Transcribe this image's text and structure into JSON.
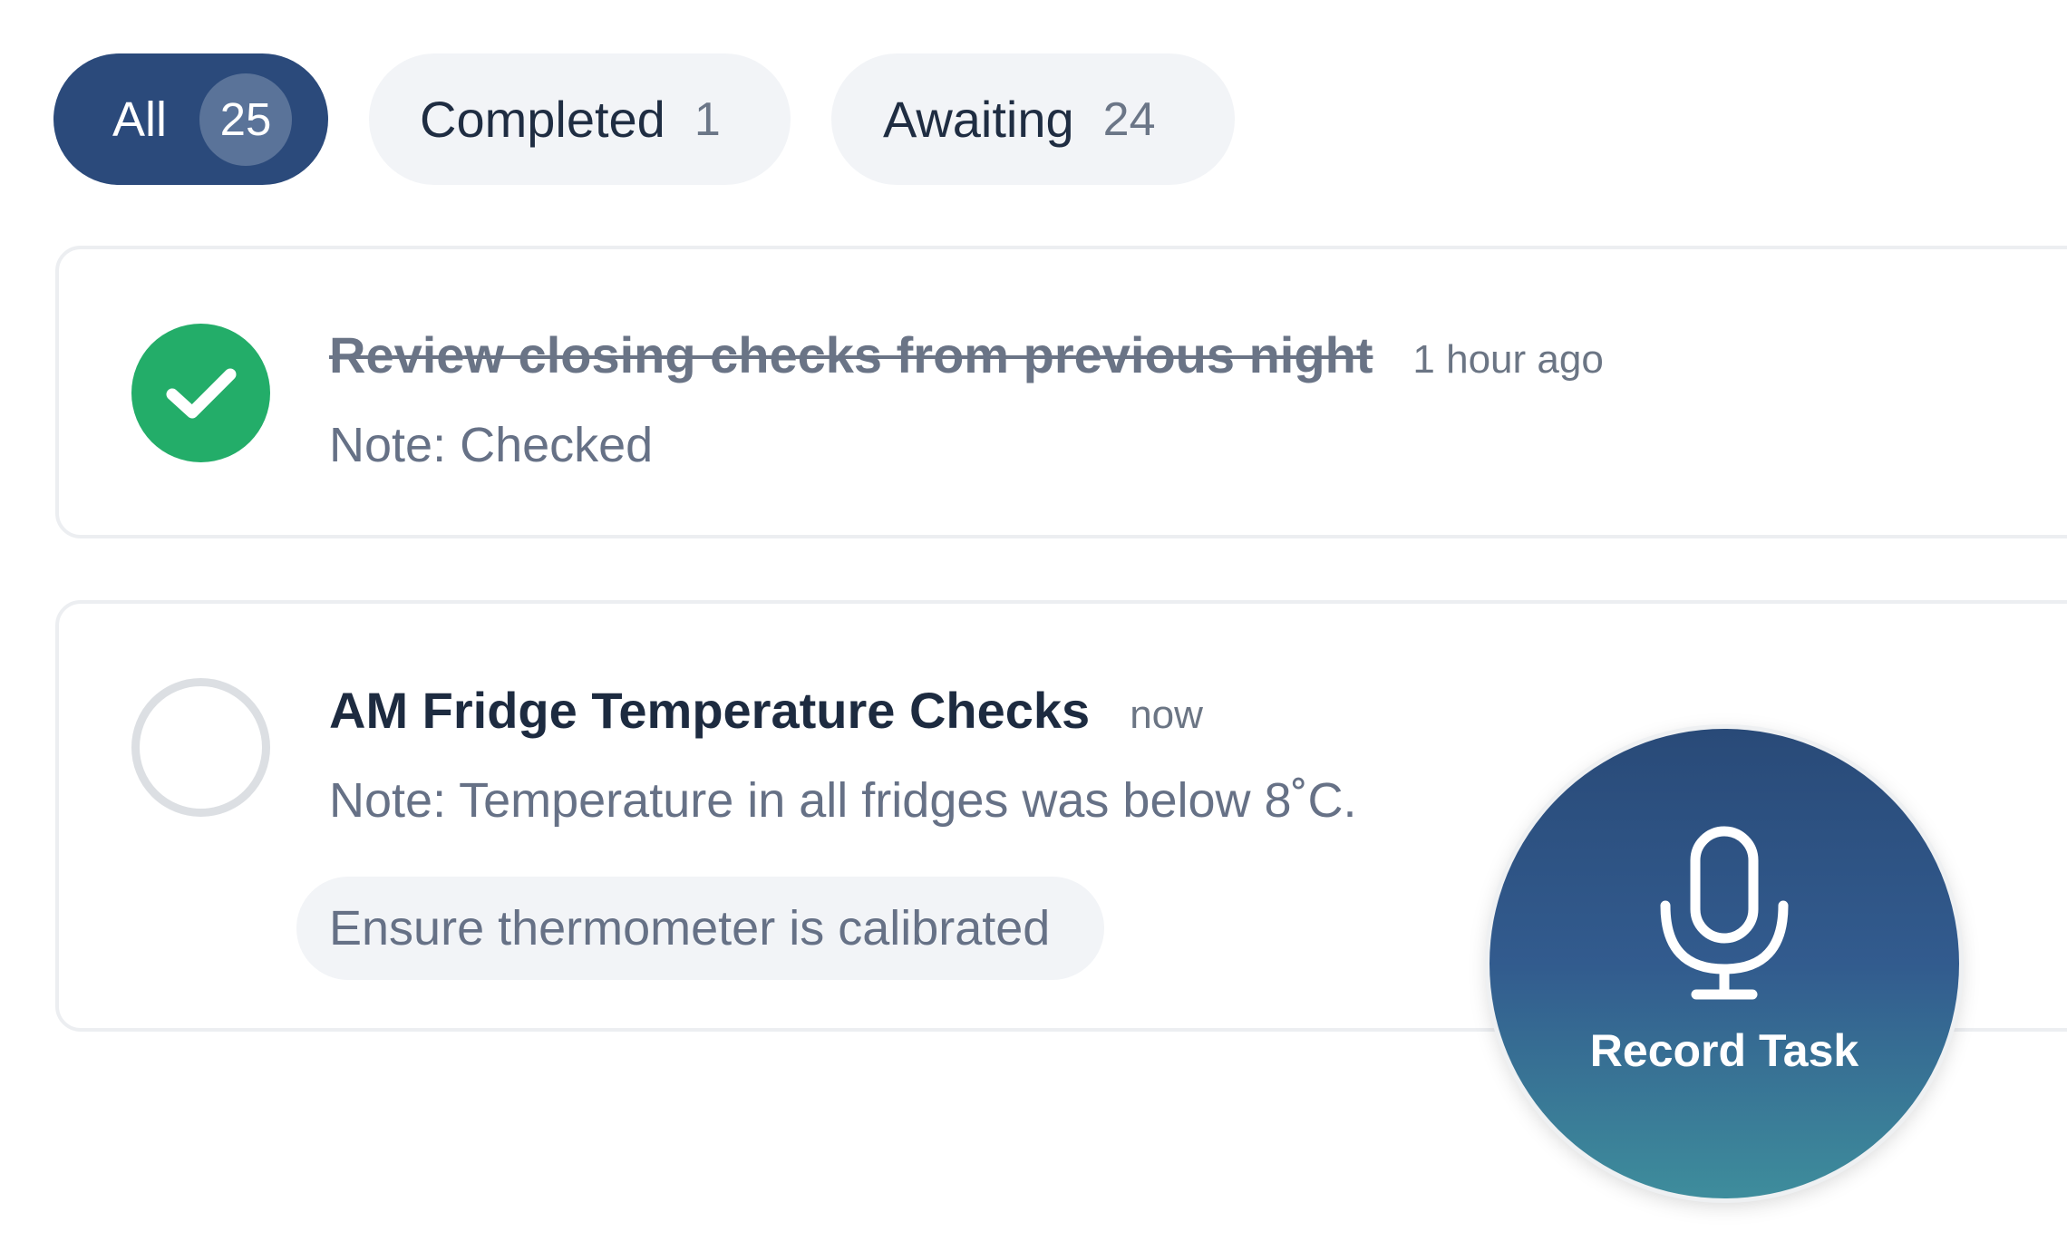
{
  "filters": [
    {
      "label": "All",
      "count": "25"
    },
    {
      "label": "Completed",
      "count": "1"
    },
    {
      "label": "Awaiting",
      "count": "24"
    }
  ],
  "tasks": [
    {
      "title": "Review closing checks from previous night",
      "time": "1 hour ago",
      "note": "Note: Checked",
      "status": "completed",
      "status_icon": "check-icon"
    },
    {
      "title": "AM Fridge Temperature Checks",
      "time": "now",
      "note": "Note: Temperature in all fridges was below 8˚C.",
      "chip": "Ensure thermometer is calibrated",
      "status": "awaiting",
      "status_icon": "empty-circle"
    }
  ],
  "record": {
    "label": "Record Task",
    "icon": "microphone-icon"
  },
  "colors": {
    "active_tab": "#2b4a7b",
    "success": "#23ad69",
    "record_gradient_top": "#294a78",
    "record_gradient_bottom": "#3e8d9c"
  }
}
